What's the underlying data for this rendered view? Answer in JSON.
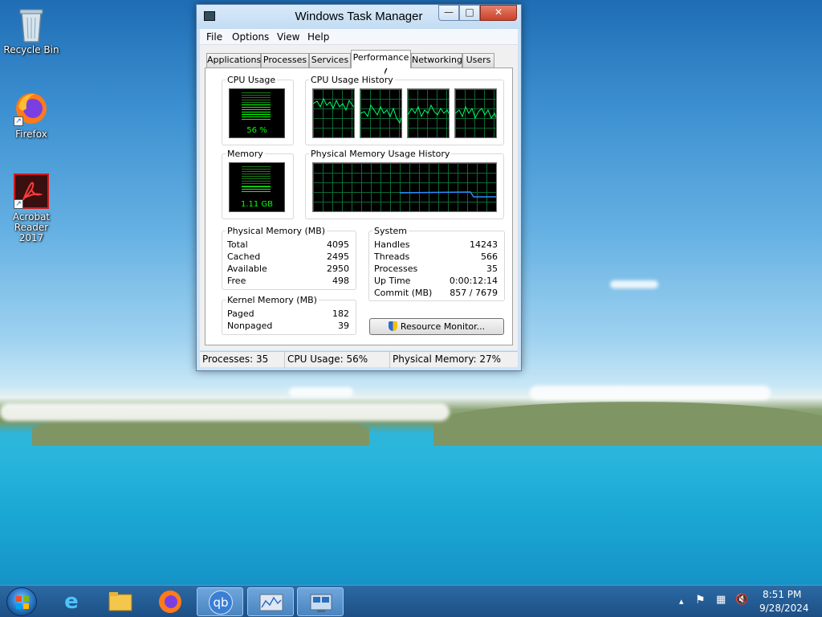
{
  "desktop": {
    "icons": [
      {
        "label": "Recycle Bin"
      },
      {
        "label": "Firefox"
      },
      {
        "label": "Acrobat Reader 2017"
      }
    ]
  },
  "window": {
    "title": "Windows Task Manager",
    "min_glyph": "—",
    "max_glyph": "□",
    "close_glyph": "✕"
  },
  "menu": [
    "File",
    "Options",
    "View",
    "Help"
  ],
  "tabs": {
    "items": [
      "Applications",
      "Processes",
      "Services",
      "Performance",
      "Networking",
      "Users"
    ],
    "active": "Performance"
  },
  "performance": {
    "cpu_usage_label": "CPU Usage",
    "cpu_usage_value": "56 %",
    "cpu_usage_fraction": 0.56,
    "cpu_history_label": "CPU Usage History",
    "memory_label": "Memory",
    "memory_value": "1.11 GB",
    "memory_fraction": 0.27,
    "mem_history_label": "Physical Memory Usage History",
    "physical_memory": {
      "label": "Physical Memory (MB)",
      "rows": [
        {
          "key": "Total",
          "value": "4095"
        },
        {
          "key": "Cached",
          "value": "2495"
        },
        {
          "key": "Available",
          "value": "2950"
        },
        {
          "key": "Free",
          "value": "498"
        }
      ]
    },
    "kernel_memory": {
      "label": "Kernel Memory (MB)",
      "rows": [
        {
          "key": "Paged",
          "value": "182"
        },
        {
          "key": "Nonpaged",
          "value": "39"
        }
      ]
    },
    "system": {
      "label": "System",
      "rows": [
        {
          "key": "Handles",
          "value": "14243"
        },
        {
          "key": "Threads",
          "value": "566"
        },
        {
          "key": "Processes",
          "value": "35"
        },
        {
          "key": "Up Time",
          "value": "0:00:12:14"
        },
        {
          "key": "Commit (MB)",
          "value": "857 / 7679"
        }
      ]
    },
    "resource_monitor_label": "Resource Monitor..."
  },
  "status": {
    "processes": "Processes: 35",
    "cpu": "CPU Usage: 56%",
    "memory": "Physical Memory: 27%"
  },
  "taskbar": {
    "time": "8:51 PM",
    "date": "9/28/2024",
    "qb_label": "qb"
  },
  "colors": {
    "graph_line": "#00ff66",
    "memory_line": "#2f8cff"
  }
}
